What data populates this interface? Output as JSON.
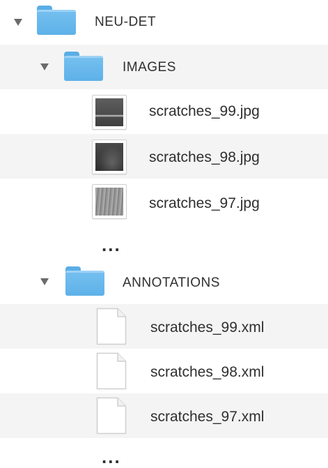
{
  "tree": {
    "root": {
      "label": "NEU-DET",
      "expanded": true
    },
    "images_folder": {
      "label": "IMAGES",
      "expanded": true,
      "files": [
        {
          "name": "scratches_99.jpg",
          "icon": "image-thumbnail-icon"
        },
        {
          "name": "scratches_98.jpg",
          "icon": "image-thumbnail-icon"
        },
        {
          "name": "scratches_97.jpg",
          "icon": "image-thumbnail-icon"
        }
      ],
      "more": "..."
    },
    "annotations_folder": {
      "label": "ANNOTATIONS",
      "expanded": true,
      "files": [
        {
          "name": "scratches_99.xml",
          "icon": "document-icon"
        },
        {
          "name": "scratches_98.xml",
          "icon": "document-icon"
        },
        {
          "name": "scratches_97.xml",
          "icon": "document-icon"
        }
      ],
      "more": "..."
    }
  },
  "colors": {
    "folder": "#6bb9ee",
    "row_alt": "#f4f4f5",
    "text": "#2f2f2f"
  }
}
